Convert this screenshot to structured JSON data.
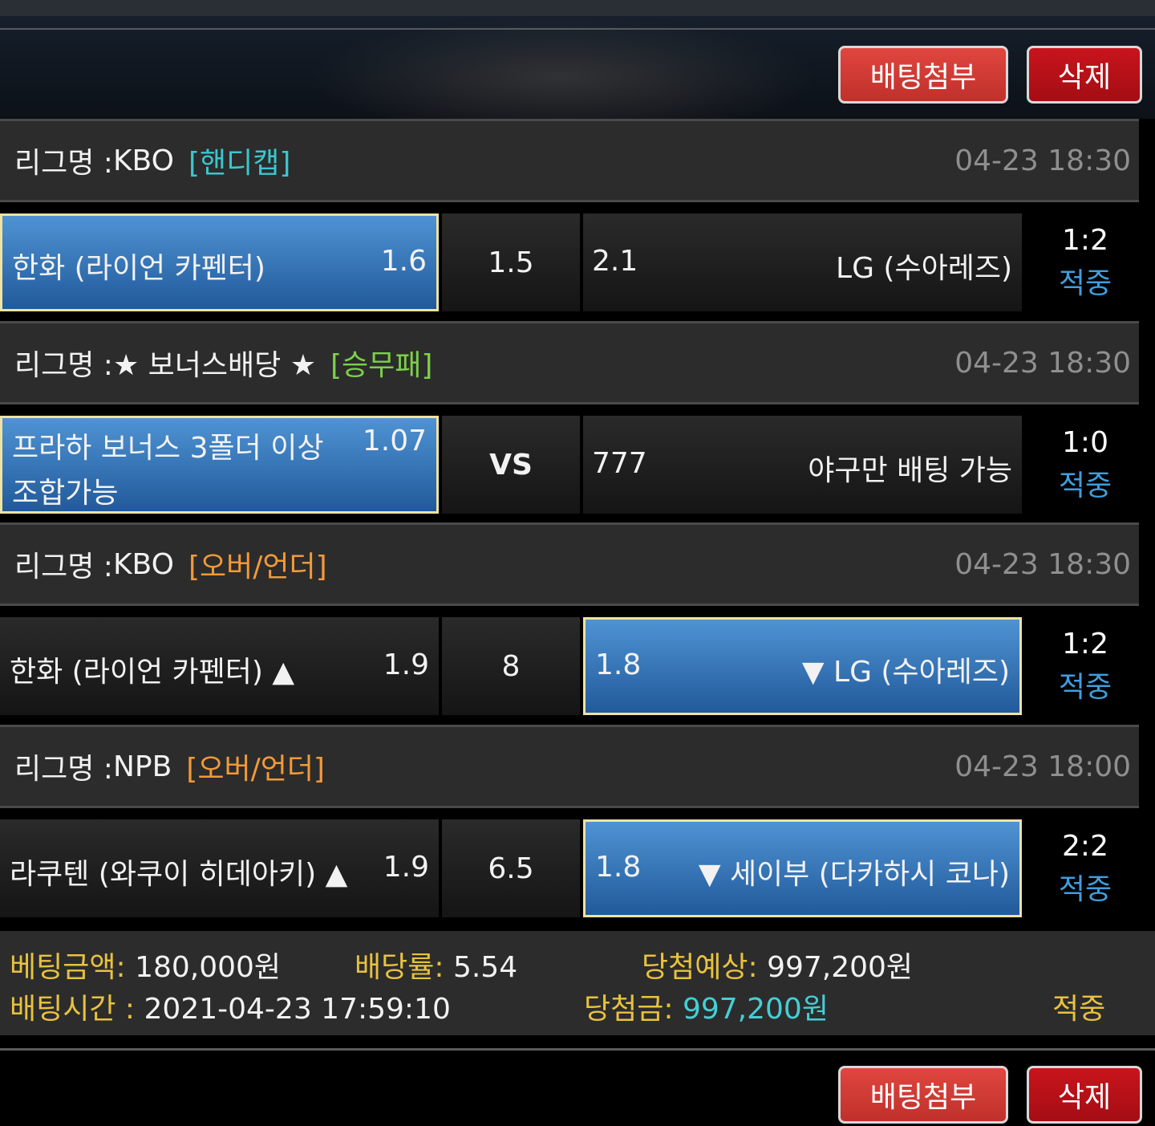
{
  "buttons": {
    "attach": "배팅첨부",
    "delete": "삭제"
  },
  "league_prefix": "리그명 : ",
  "bets": [
    {
      "league": "KBO",
      "tag": "[핸디캡]",
      "time": "04-23 18:30",
      "home_name": "한화 (라이언 카펜터)",
      "home_odds": "1.6",
      "middle": "1.5",
      "away_odds": "2.1",
      "away_name": "LG (수아레즈)",
      "score": "1:2",
      "result": "적중",
      "selected": "home"
    },
    {
      "league": "★ 보너스배당 ★",
      "tag": "[승무패]",
      "time": "04-23 18:30",
      "home_name_line1": "프라하 보너스 3폴더 이상",
      "home_name_line2": "조합가능",
      "home_odds": "1.07",
      "middle": "VS",
      "away_odds": "777",
      "away_name": "야구만 배팅 가능",
      "score": "1:0",
      "result": "적중",
      "selected": "home"
    },
    {
      "league": "KBO",
      "tag": "[오버/언더]",
      "time": "04-23 18:30",
      "home_name": "한화 (라이언 카펜터) ▲",
      "home_odds": "1.9",
      "middle": "8",
      "away_odds": "1.8",
      "away_name": "▼ LG (수아레즈)",
      "score": "1:2",
      "result": "적중",
      "selected": "away"
    },
    {
      "league": "NPB",
      "tag": "[오버/언더]",
      "time": "04-23 18:00",
      "home_name": "라쿠텐 (와쿠이 히데아키) ▲",
      "home_odds": "1.9",
      "middle": "6.5",
      "away_odds": "1.8",
      "away_name": "▼ 세이부 (다카하시 코나)",
      "score": "2:2",
      "result": "적중",
      "selected": "away"
    }
  ],
  "summary": {
    "bet_amount_label": "베팅금액:",
    "bet_amount": "180,000원",
    "rate_label": "배당률:",
    "rate": "5.54",
    "expected_label": "당첨예상:",
    "expected": "997,200원",
    "bet_time_label": "배팅시간 :",
    "bet_time": "2021-04-23 17:59:10",
    "prize_label": "당첨금:",
    "prize": "997,200원",
    "status": "적중"
  },
  "colors": {
    "selected_cell": "#3a7cc0",
    "selected_border": "#f0e2a0",
    "tag_handicap": "#39c7cf",
    "tag_win_draw_lose": "#7cd148",
    "tag_over_under": "#f29a38",
    "result_hit": "#3f9ee0",
    "summary_label": "#e8c23f",
    "button_attach": "#d43c36",
    "button_delete": "#b8101a"
  }
}
